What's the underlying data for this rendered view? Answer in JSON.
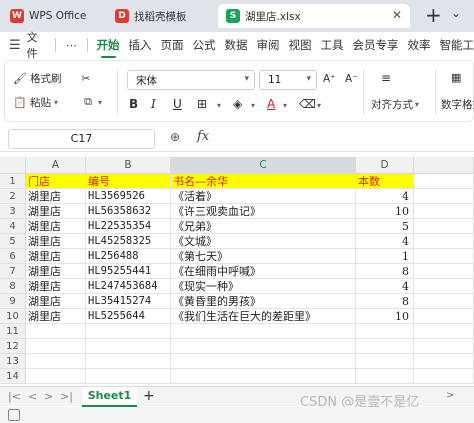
{
  "titlebar": {
    "tabs": [
      {
        "label": "WPS Office",
        "icon": "wps-logo-icon"
      },
      {
        "label": "找稻壳模板",
        "icon": "docer-icon"
      },
      {
        "label": "湖里店.xlsx",
        "icon": "spreadsheet-icon",
        "active": true
      }
    ]
  },
  "menu": {
    "file": "文件",
    "items": [
      "开始",
      "插入",
      "页面",
      "公式",
      "数据",
      "审阅",
      "视图",
      "工具",
      "会员专享",
      "效率",
      "智能工"
    ],
    "active": "开始"
  },
  "ribbon": {
    "format_painter": "格式刷",
    "paste": "粘贴",
    "font_name": "宋体",
    "font_size": "11",
    "align": "对齐方式",
    "number_format": "数字格式",
    "bold": "B",
    "italic": "I",
    "underline": "U",
    "font_color_letter": "A"
  },
  "formula_bar": {
    "name_box": "C17",
    "fx": "fx",
    "formula": ""
  },
  "grid": {
    "columns": [
      "A",
      "B",
      "C",
      "D"
    ],
    "row_numbers": [
      "1",
      "2",
      "3",
      "4",
      "5",
      "6",
      "7",
      "8",
      "9",
      "10",
      "11",
      "12",
      "13",
      "14"
    ],
    "header": [
      "门店",
      "编号",
      "书名—余华",
      "本数"
    ],
    "rows": [
      [
        "湖里店",
        "HL3569526",
        "《活着》",
        "4"
      ],
      [
        "湖里店",
        "HL56358632",
        "《许三观卖血记》",
        "10"
      ],
      [
        "湖里店",
        "HL22535354",
        "《兄弟》",
        "5"
      ],
      [
        "湖里店",
        "HL45258325",
        "《文城》",
        "4"
      ],
      [
        "湖里店",
        "HL256488",
        "《第七天》",
        "1"
      ],
      [
        "湖里店",
        "HL95255441",
        "《在细雨中呼喊》",
        "8"
      ],
      [
        "湖里店",
        "HL247453684",
        "《现实一种》",
        "4"
      ],
      [
        "湖里店",
        "HL35415274",
        "《黄昏里的男孩》",
        "8"
      ],
      [
        "湖里店",
        "HL5255644",
        "《我们生活在巨大的差距里》",
        "10"
      ]
    ]
  },
  "sheets": {
    "tabs": [
      "Sheet1"
    ],
    "active": "Sheet1"
  },
  "watermark": "CSDN @是壹不是亿",
  "colors": {
    "accent": "#1a8a45",
    "header_fill": "#ffff00",
    "header_text": "#e02020"
  }
}
